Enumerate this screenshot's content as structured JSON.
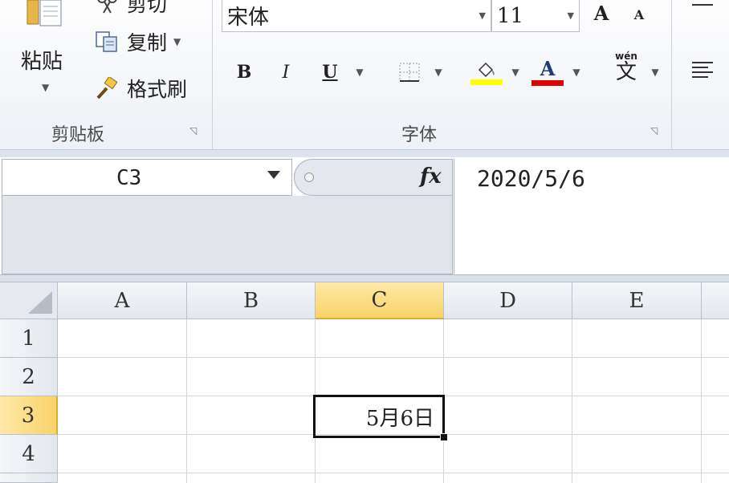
{
  "ribbon": {
    "clipboard": {
      "paste_label": "粘贴",
      "cut_label": "剪切",
      "copy_label": "复制",
      "format_painter_label": "格式刷",
      "group_label": "剪贴板"
    },
    "font": {
      "font_name": "宋体",
      "font_size": "11",
      "bold": "B",
      "italic": "I",
      "underline": "U",
      "grow_font": "A",
      "shrink_font": "A",
      "font_color_letter": "A",
      "phonetic_top": "wén",
      "phonetic_char": "文",
      "group_label": "字体",
      "highlight_color": "#ffff00",
      "font_color": "#e00000"
    }
  },
  "formula_bar": {
    "name_box": "C3",
    "fx_label": "fx",
    "value": "2020/5/6"
  },
  "sheet": {
    "columns": [
      "A",
      "B",
      "C",
      "D",
      "E"
    ],
    "rows": [
      "1",
      "2",
      "3",
      "4"
    ],
    "selected_column": "C",
    "selected_row": "3",
    "cell_c3": "5月6日"
  },
  "colors": {
    "selected_header": "#f9d26a",
    "grid_line": "#d4d8de"
  }
}
